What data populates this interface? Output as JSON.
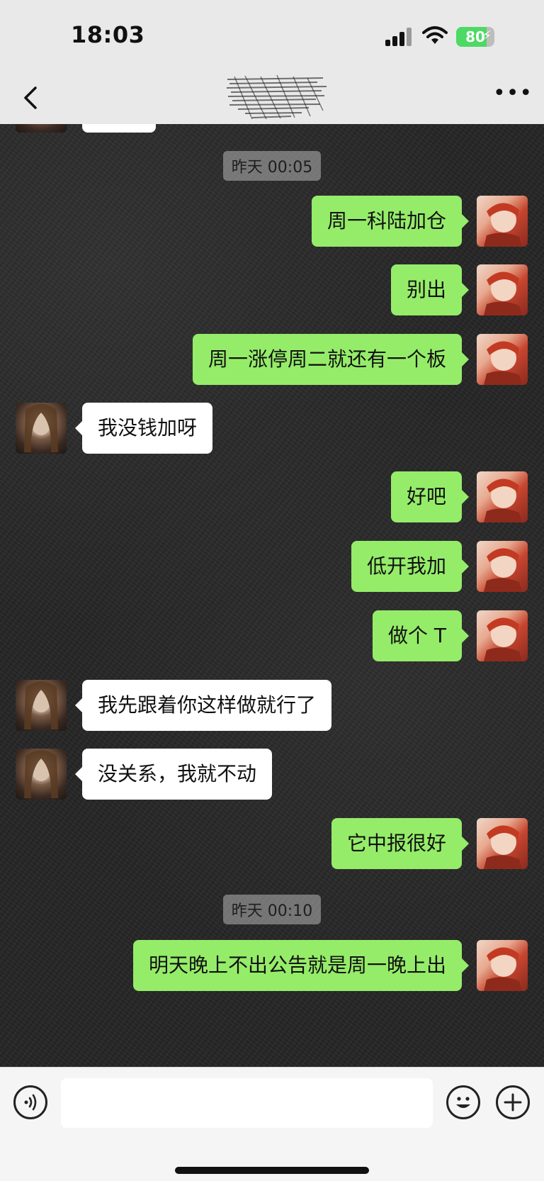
{
  "status_bar": {
    "time": "18:03",
    "battery": "80",
    "battery_level": 0.8,
    "icons": [
      "signal-icon",
      "wifi-icon",
      "battery-icon",
      "charging-bolt-icon"
    ]
  },
  "nav": {
    "back_icon": "chevron-left-icon",
    "title": "",
    "title_obscured": true,
    "more_icon": "more-dots-icon"
  },
  "chat": {
    "timestamps": [
      "昨天 00:05",
      "昨天 00:10"
    ],
    "messages": [
      {
        "sender": "me",
        "text": "周一科陆加仓"
      },
      {
        "sender": "me",
        "text": "别出"
      },
      {
        "sender": "me",
        "text": "周一涨停周二就还有一个板"
      },
      {
        "sender": "her",
        "text": "我没钱加呀"
      },
      {
        "sender": "me",
        "text": "好吧"
      },
      {
        "sender": "me",
        "text": "低开我加"
      },
      {
        "sender": "me",
        "text": "做个 T"
      },
      {
        "sender": "her",
        "text": "我先跟着你这样做就行了"
      },
      {
        "sender": "her",
        "text": "没关系，我就不动"
      },
      {
        "sender": "me",
        "text": "它中报很好"
      },
      {
        "sender": "me",
        "text": "明天晚上不出公告就是周一晚上出"
      }
    ]
  },
  "input_bar": {
    "voice_icon": "voice-icon",
    "input_value": "",
    "emoji_icon": "emoji-icon",
    "plus_icon": "plus-icon"
  },
  "colors": {
    "my_bubble": "#95ec69",
    "their_bubble": "#ffffff",
    "chat_background": "#262626",
    "battery_green": "#4cd964"
  }
}
